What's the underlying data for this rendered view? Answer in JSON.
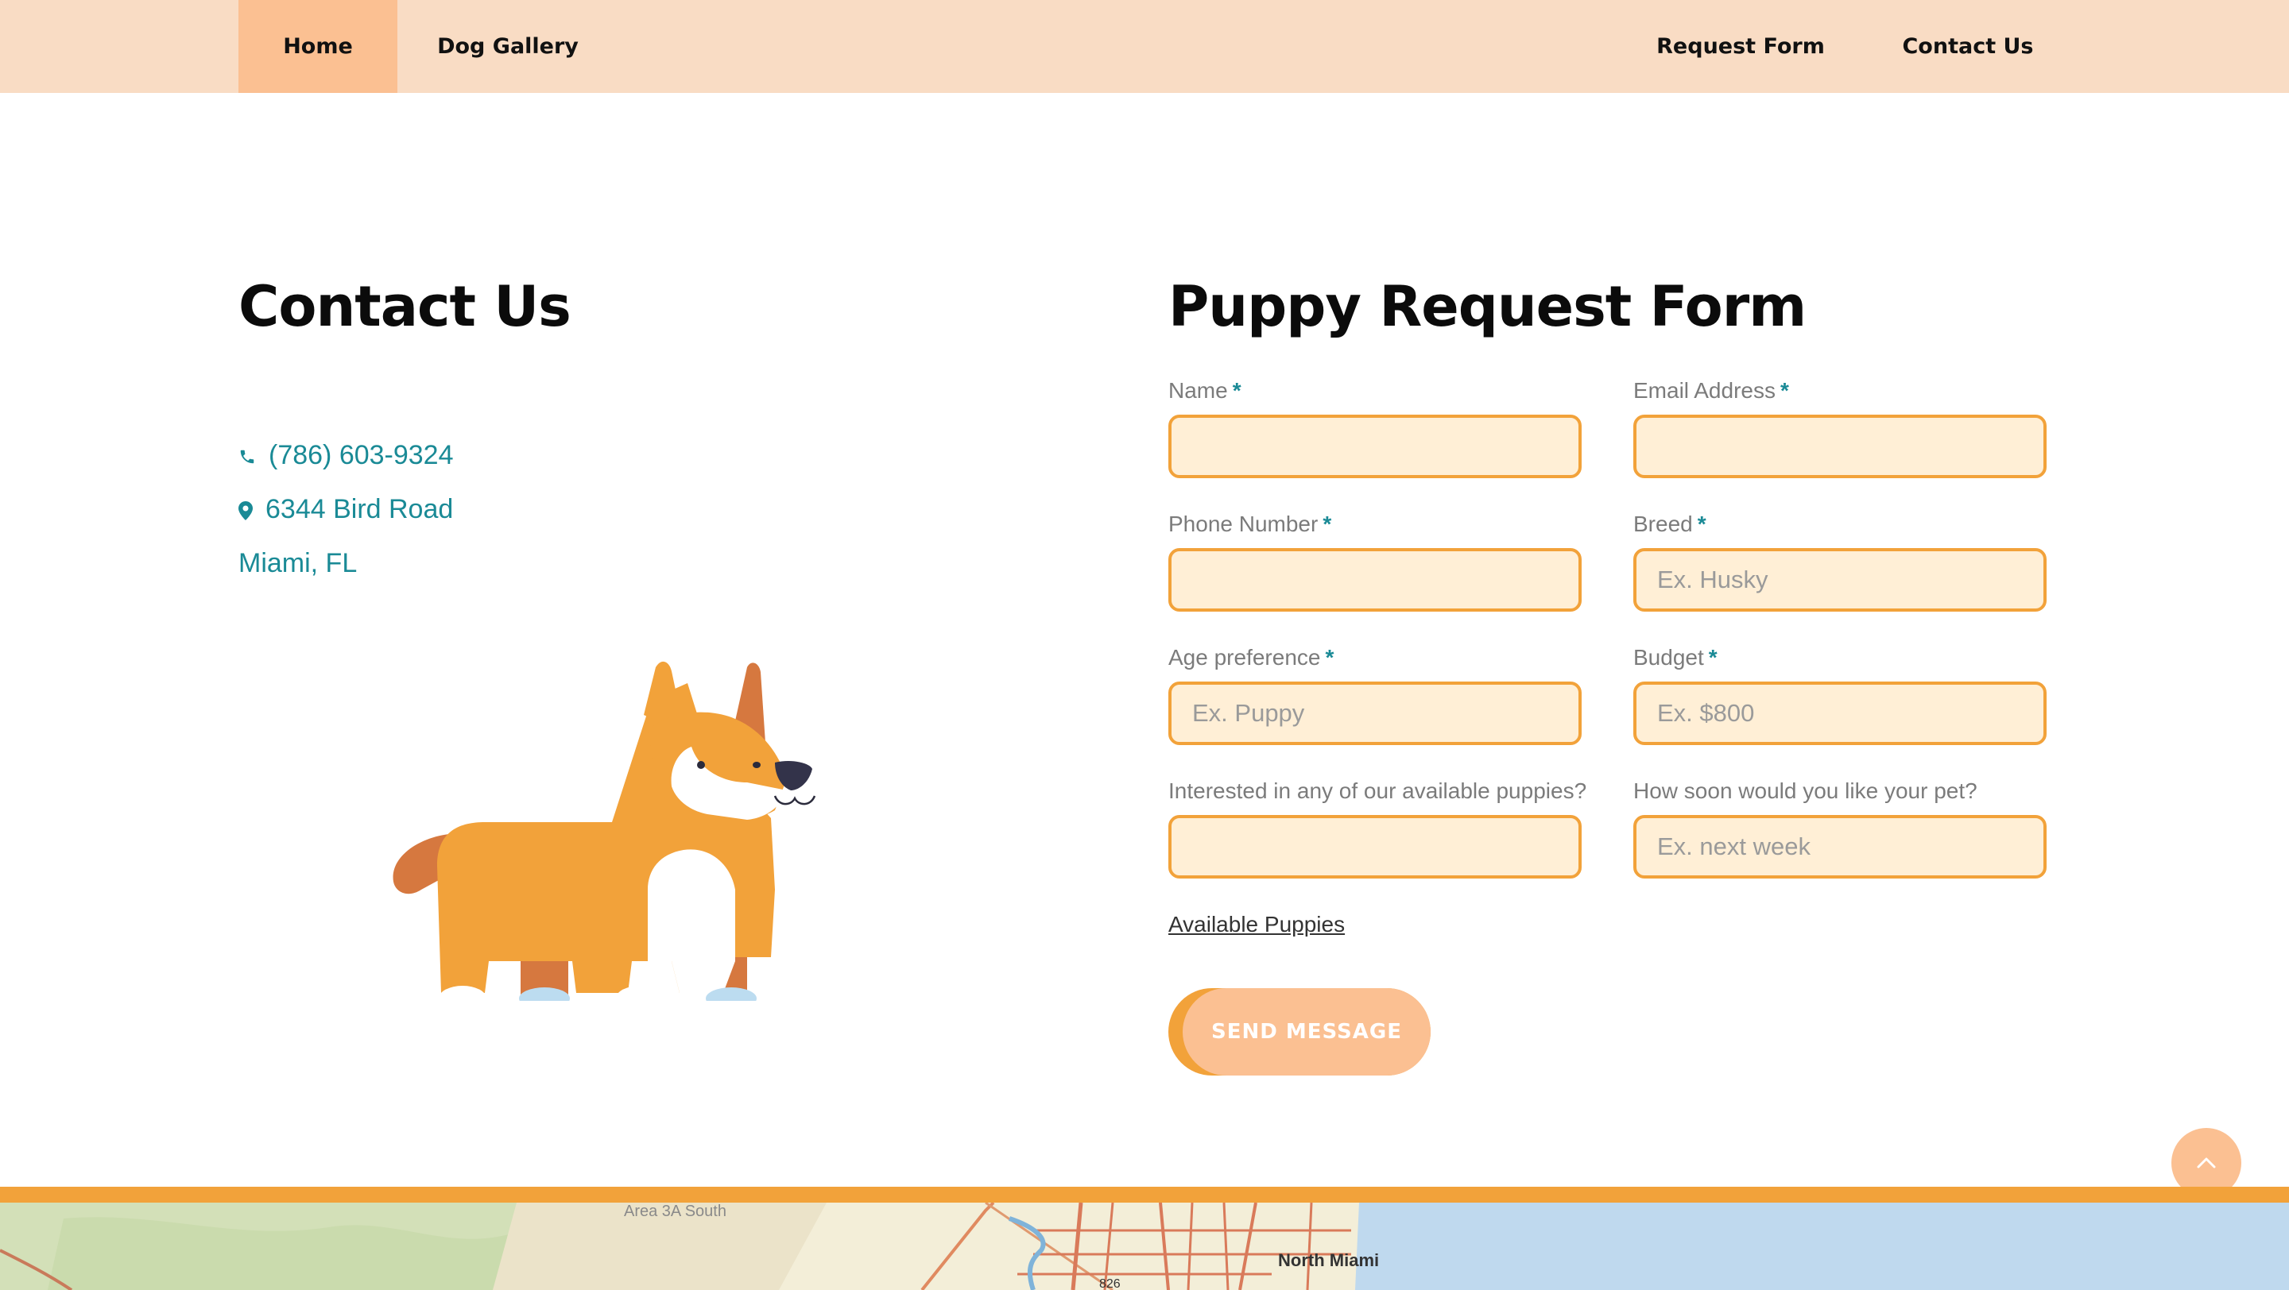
{
  "nav": {
    "home": "Home",
    "gallery": "Dog Gallery",
    "request": "Request Form",
    "contact": "Contact Us"
  },
  "contact": {
    "title": "Contact Us",
    "phone": "(786) 603-9324",
    "address": "6344 Bird Road",
    "city": "Miami, FL",
    "phone_icon": "phone-icon",
    "address_icon": "map-pin-icon"
  },
  "form": {
    "title": "Puppy Request Form",
    "required_mark": "*",
    "fields": {
      "name": {
        "label": "Name",
        "placeholder": "",
        "value": ""
      },
      "email": {
        "label": "Email Address",
        "placeholder": "",
        "value": ""
      },
      "phone": {
        "label": "Phone Number",
        "placeholder": "",
        "value": ""
      },
      "breed": {
        "label": "Breed",
        "placeholder": "Ex. Husky",
        "value": ""
      },
      "age": {
        "label": "Age preference",
        "placeholder": "Ex. Puppy",
        "value": ""
      },
      "budget": {
        "label": "Budget",
        "placeholder": "Ex. $800",
        "value": ""
      },
      "interested": {
        "label": "Interested in any of our available puppies?",
        "placeholder": "",
        "value": ""
      },
      "how_soon": {
        "label": "How soon would you like your pet?",
        "placeholder": "Ex. next week",
        "value": ""
      }
    },
    "available_link": "Available Puppies",
    "submit": "SEND MESSAGE"
  },
  "map": {
    "label_1": "Area 3A South",
    "label_2": "North Miami",
    "label_3": "826"
  },
  "colors": {
    "nav_bg": "#f9dcc4",
    "nav_active": "#fbc092",
    "accent": "#f2a23a",
    "field_bg": "#ffefd6",
    "link_teal": "#1a8a96",
    "water": "#bfd9ee"
  }
}
